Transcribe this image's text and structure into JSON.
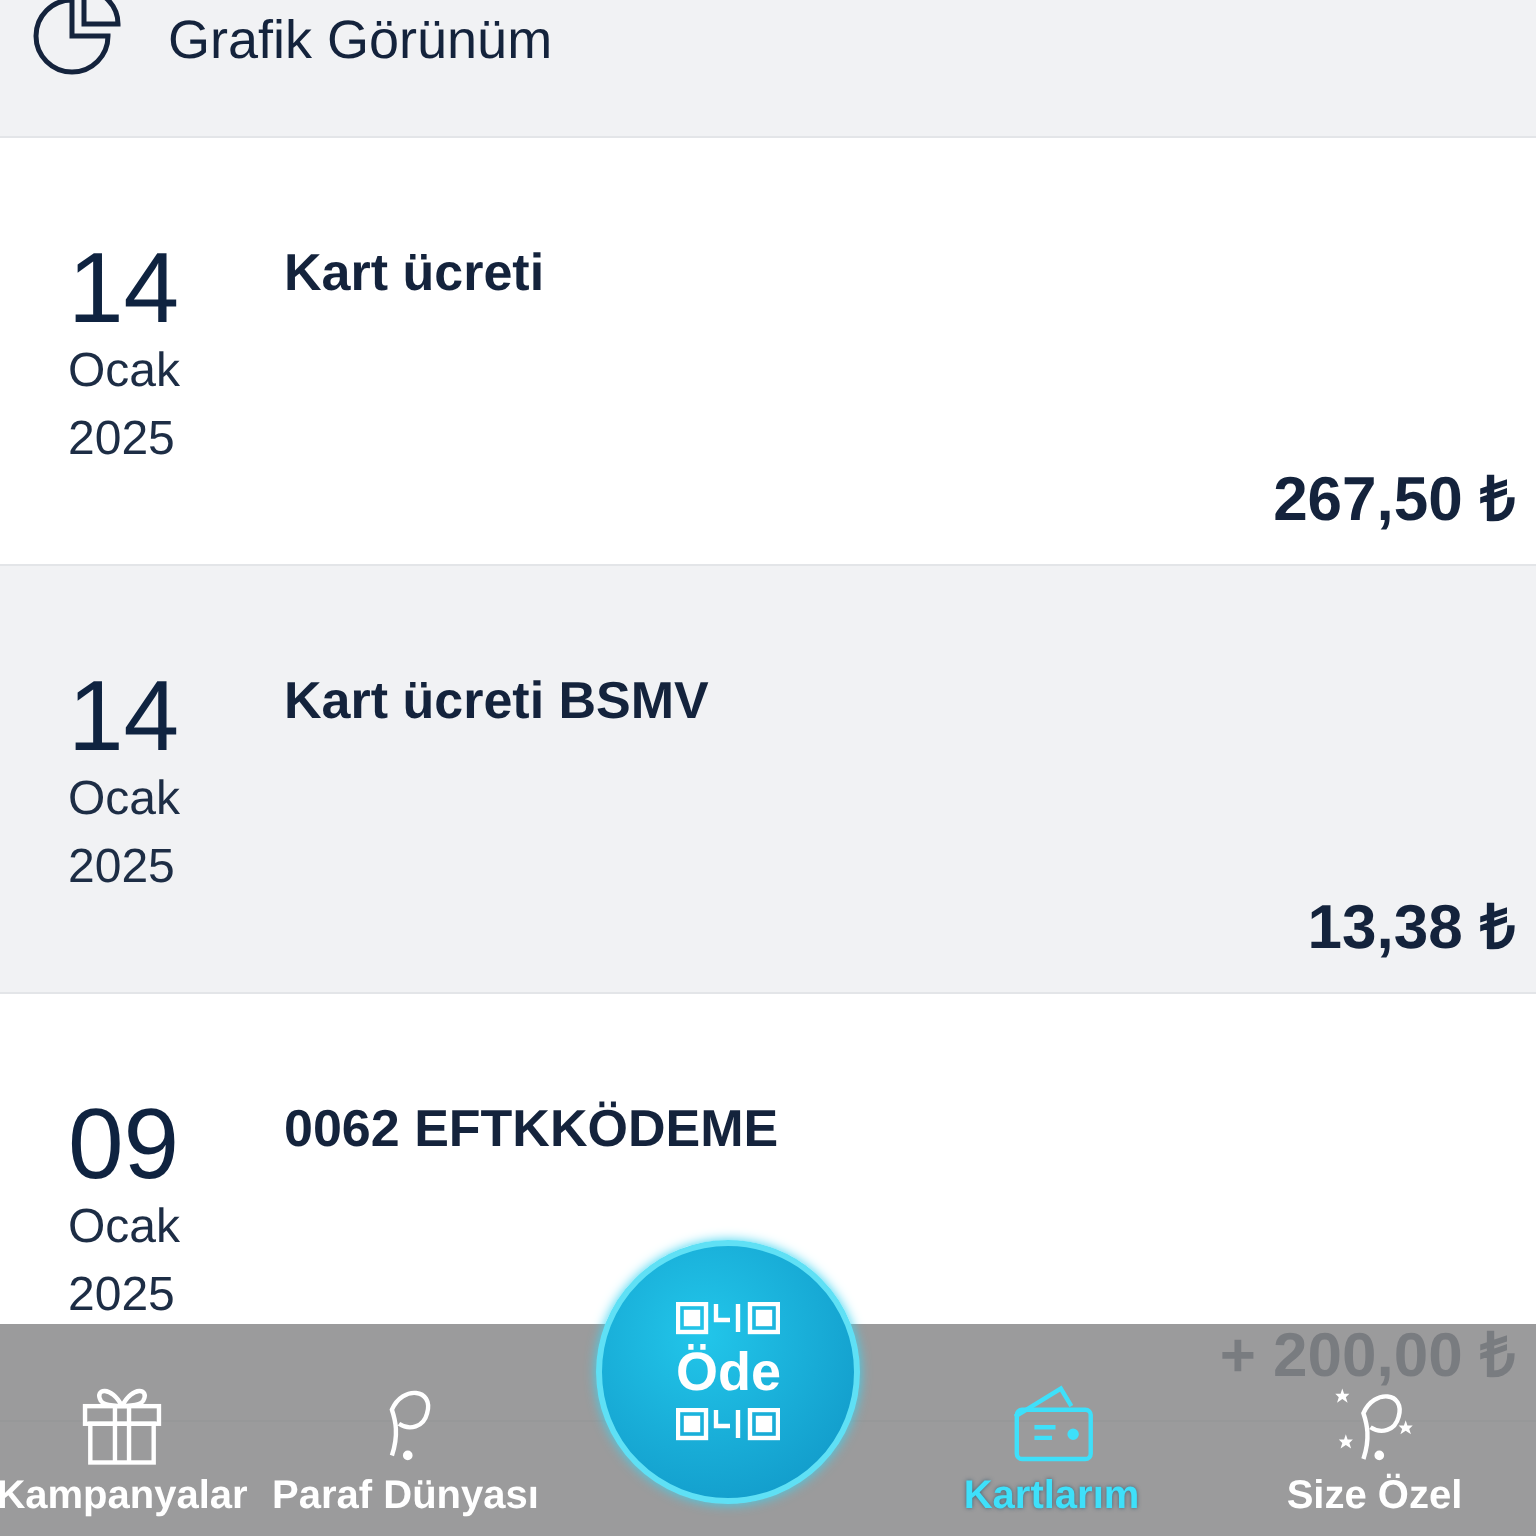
{
  "header": {
    "title": "Grafik Görünüm"
  },
  "transactions": [
    {
      "day": "14",
      "month": "Ocak",
      "year": "2025",
      "description": "Kart ücreti",
      "amount": "267,50 ₺"
    },
    {
      "day": "14",
      "month": "Ocak",
      "year": "2025",
      "description": "Kart ücreti BSMV",
      "amount": "13,38 ₺"
    },
    {
      "day": "09",
      "month": "Ocak",
      "year": "2025",
      "description": "0062 EFTKKÖDEME",
      "amount": "+ 200,00 ₺"
    }
  ],
  "nav": [
    {
      "kind": "gift",
      "label": "Kampanyalar",
      "selected": false
    },
    {
      "kind": "paraf",
      "label": "Paraf Dünyası",
      "selected": false
    },
    {
      "kind": "pay",
      "label": "Öde",
      "selected": false
    },
    {
      "kind": "cards",
      "label": "Kartlarım",
      "selected": true
    },
    {
      "kind": "special",
      "label": "Size Özel",
      "selected": false
    }
  ]
}
